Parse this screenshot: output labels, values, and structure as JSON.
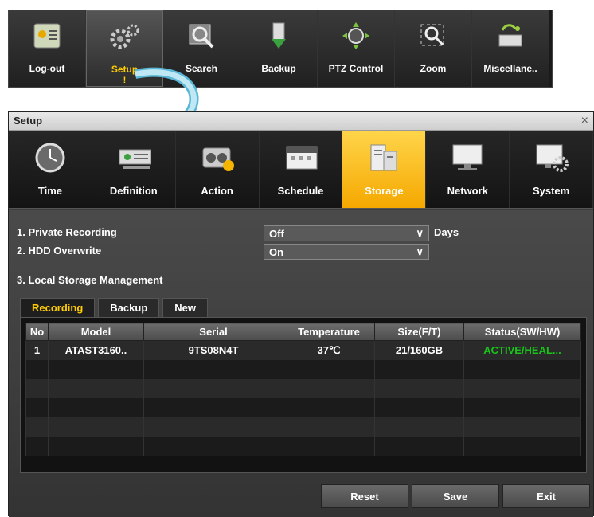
{
  "topmenu": {
    "items": [
      {
        "label": "Log-out",
        "icon": "logout-icon"
      },
      {
        "label": "Setup",
        "icon": "gear-icon"
      },
      {
        "label": "Search",
        "icon": "search-icon"
      },
      {
        "label": "Backup",
        "icon": "backup-icon"
      },
      {
        "label": "PTZ Control",
        "icon": "ptz-icon"
      },
      {
        "label": "Zoom",
        "icon": "zoom-icon"
      },
      {
        "label": "Miscellane..",
        "icon": "misc-icon"
      }
    ],
    "active_mark": "!"
  },
  "dialog": {
    "title": "Setup",
    "close": "×",
    "tabs": [
      {
        "label": "Time"
      },
      {
        "label": "Definition"
      },
      {
        "label": "Action"
      },
      {
        "label": "Schedule"
      },
      {
        "label": "Storage"
      },
      {
        "label": "Network"
      },
      {
        "label": "System"
      }
    ]
  },
  "storage": {
    "private_recording_label": "1. Private Recording",
    "private_recording_value": "Off",
    "private_recording_unit": "Days",
    "hdd_overwrite_label": "2. HDD Overwrite",
    "hdd_overwrite_value": "On",
    "local_storage_label": "3. Local Storage Management",
    "subtabs": [
      "Recording",
      "Backup",
      "New"
    ],
    "columns": [
      "No",
      "Model",
      "Serial",
      "Temperature",
      "Size(F/T)",
      "Status(SW/HW)"
    ],
    "rows": [
      {
        "no": "1",
        "model": "ATAST3160..",
        "serial": "9TS08N4T",
        "temp": "37℃",
        "size": "21/160GB",
        "status": "ACTIVE/HEAL..."
      }
    ],
    "buttons": {
      "reset": "Reset",
      "save": "Save",
      "exit": "Exit"
    }
  },
  "colors": {
    "accent": "#f5a800",
    "status_ok": "#19c319",
    "active_label": "#ffcc00"
  }
}
